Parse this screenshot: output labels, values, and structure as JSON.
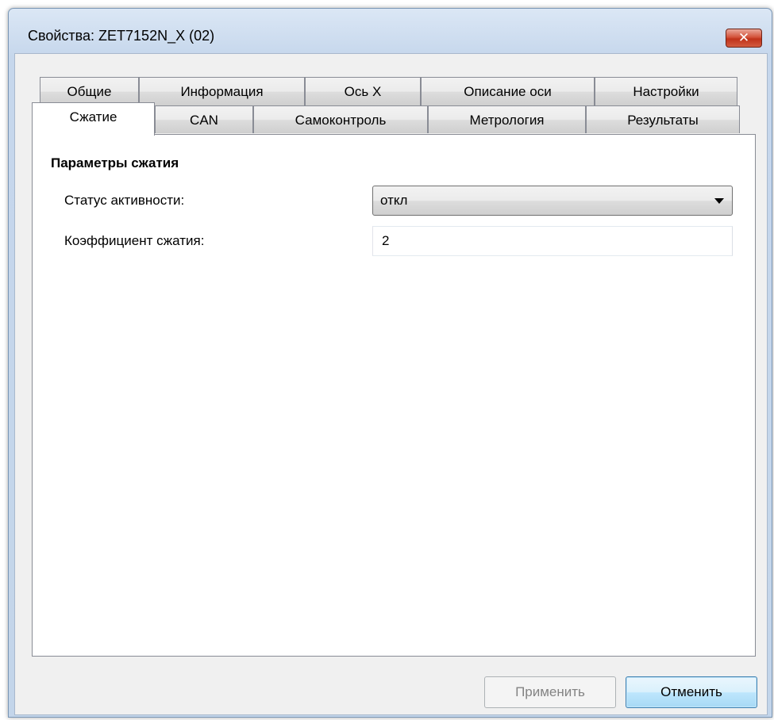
{
  "window": {
    "title": "Свойства: ZET7152N_X (02)",
    "close_label": "✕"
  },
  "tabs": {
    "row1": [
      {
        "label": "Общие"
      },
      {
        "label": "Информация"
      },
      {
        "label": "Ось X"
      },
      {
        "label": "Описание оси"
      },
      {
        "label": "Настройки"
      }
    ],
    "row2": [
      {
        "label": "Сжатие",
        "active": true
      },
      {
        "label": "CAN"
      },
      {
        "label": "Самоконтроль"
      },
      {
        "label": "Метрология"
      },
      {
        "label": "Результаты"
      }
    ]
  },
  "compression": {
    "group_title": "Параметры сжатия",
    "status_label": "Статус активности:",
    "status_value": "откл",
    "ratio_label": "Коэффициент сжатия:",
    "ratio_value": "2"
  },
  "buttons": {
    "apply": "Применить",
    "apply_enabled": false,
    "cancel": "Отменить"
  },
  "colors": {
    "titlebar": "#c6d7ec",
    "close_button": "#c0321a",
    "default_button_border": "#3c7fb1"
  }
}
